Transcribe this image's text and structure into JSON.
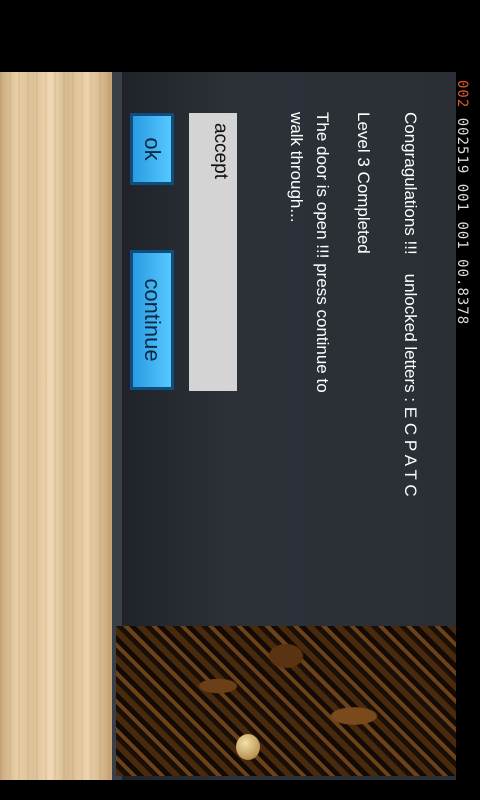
{
  "hud": {
    "lives": "002",
    "stats": "002519  001  001  00.8378"
  },
  "dialog": {
    "congrats": "Congragulations !!!",
    "unlocked": "unlocked letters : E C P A T C",
    "level": "Level  3  Completed",
    "message_line1": "The door is open !!! press continue to",
    "message_line2": "walk through..."
  },
  "input": {
    "value": "accept"
  },
  "buttons": {
    "ok": "ok",
    "continue": "continue"
  }
}
